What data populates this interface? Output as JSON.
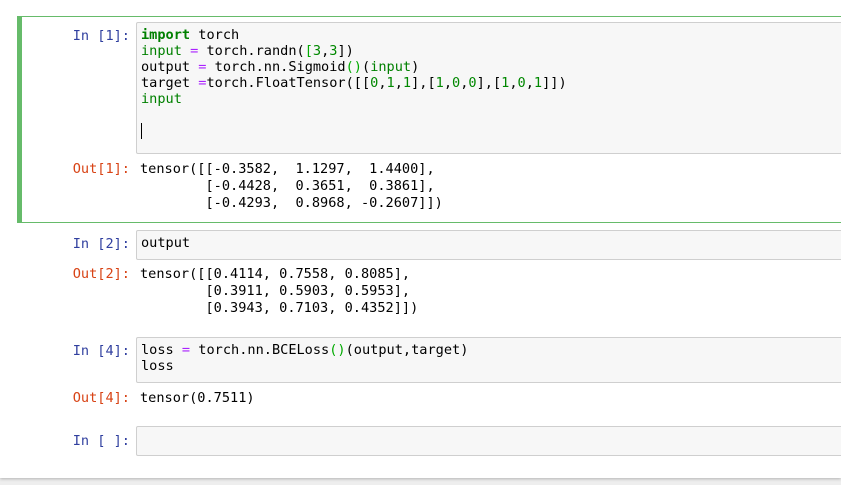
{
  "cells": [
    {
      "in_prompt": "In [1]:",
      "code_lines": [
        [
          {
            "t": "import",
            "c": "kw"
          },
          {
            "t": " torch"
          }
        ],
        [
          {
            "t": "input",
            "c": "nb"
          },
          {
            "t": " "
          },
          {
            "t": "=",
            "c": "op"
          },
          {
            "t": " torch.randn("
          },
          {
            "t": "[",
            "c": "br"
          },
          {
            "t": "3",
            "c": "num"
          },
          {
            "t": ","
          },
          {
            "t": "3",
            "c": "num"
          },
          {
            "t": "])"
          }
        ],
        [
          {
            "t": "output "
          },
          {
            "t": "=",
            "c": "op"
          },
          {
            "t": " torch.nn.Sigmoid"
          },
          {
            "t": "()",
            "c": "br"
          },
          {
            "t": "("
          },
          {
            "t": "input",
            "c": "nb"
          },
          {
            "t": ")"
          }
        ],
        [
          {
            "t": "target "
          },
          {
            "t": "=",
            "c": "op"
          },
          {
            "t": "torch.FloatTensor([["
          },
          {
            "t": "0",
            "c": "num"
          },
          {
            "t": ","
          },
          {
            "t": "1",
            "c": "num"
          },
          {
            "t": ","
          },
          {
            "t": "1",
            "c": "num"
          },
          {
            "t": "],["
          },
          {
            "t": "1",
            "c": "num"
          },
          {
            "t": ","
          },
          {
            "t": "0",
            "c": "num"
          },
          {
            "t": ","
          },
          {
            "t": "0",
            "c": "num"
          },
          {
            "t": "],["
          },
          {
            "t": "1",
            "c": "num"
          },
          {
            "t": ","
          },
          {
            "t": "0",
            "c": "num"
          },
          {
            "t": ","
          },
          {
            "t": "1",
            "c": "num"
          },
          {
            "t": "]])"
          }
        ],
        [
          {
            "t": "input",
            "c": "nb"
          }
        ],
        [],
        []
      ],
      "out_prompt": "Out[1]:",
      "output": "tensor([[-0.3582,  1.1297,  1.4400],\n        [-0.4428,  0.3651,  0.3861],\n        [-0.4293,  0.8968, -0.2607]])"
    },
    {
      "in_prompt": "In [2]:",
      "code_lines": [
        [
          {
            "t": "output"
          }
        ]
      ],
      "out_prompt": "Out[2]:",
      "output": "tensor([[0.4114, 0.7558, 0.8085],\n        [0.3911, 0.5903, 0.5953],\n        [0.3943, 0.7103, 0.4352]])"
    },
    {
      "in_prompt": "In [4]:",
      "code_lines": [
        [
          {
            "t": "loss "
          },
          {
            "t": "=",
            "c": "op"
          },
          {
            "t": " torch.nn.BCELoss"
          },
          {
            "t": "()",
            "c": "br"
          },
          {
            "t": "(output,target)"
          }
        ],
        [
          {
            "t": "loss"
          }
        ]
      ],
      "out_prompt": "Out[4]:",
      "output": "tensor(0.7511)"
    },
    {
      "in_prompt": "In [ ]:",
      "code_lines": [
        []
      ]
    }
  ]
}
